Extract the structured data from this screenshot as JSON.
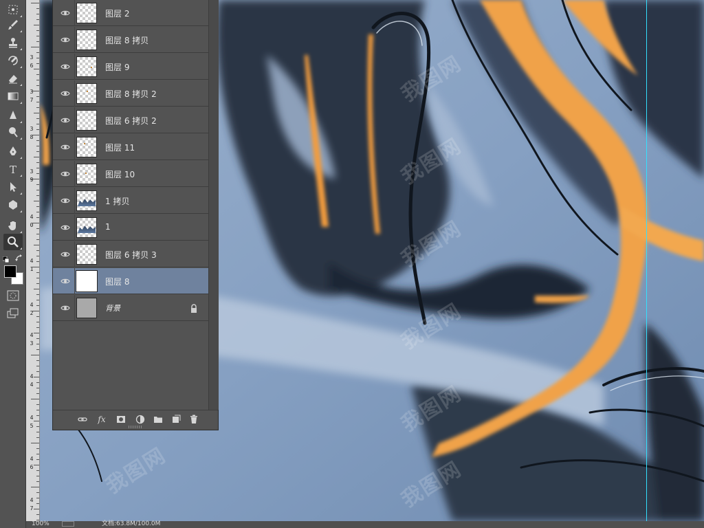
{
  "toolbar": {
    "tools": [
      {
        "name": "marquee-tool",
        "active": false
      },
      {
        "name": "brush-tool",
        "active": false
      },
      {
        "name": "stamp-tool",
        "active": false
      },
      {
        "name": "history-brush-tool",
        "active": false
      },
      {
        "name": "eraser-tool",
        "active": false
      },
      {
        "name": "gradient-tool",
        "active": false
      },
      {
        "name": "blur-tool",
        "active": false
      },
      {
        "name": "dodge-tool",
        "active": false
      },
      {
        "name": "pen-tool",
        "active": false
      },
      {
        "name": "type-tool",
        "active": false,
        "glyph": "T"
      },
      {
        "name": "path-select-tool",
        "active": false
      },
      {
        "name": "shape-tool",
        "active": false
      },
      {
        "name": "hand-tool",
        "active": false
      },
      {
        "name": "zoom-tool",
        "active": true
      }
    ],
    "foreground_color": "#000000",
    "background_color": "#ffffff"
  },
  "ruler": {
    "labels": [
      "3",
      "6",
      "3",
      "7",
      "3",
      "8",
      "3",
      "9",
      "4",
      "0",
      "4",
      "1",
      "4",
      "2",
      "4",
      "3",
      "4",
      "4",
      "4",
      "5",
      "4",
      "6",
      "4",
      "7"
    ]
  },
  "layers": [
    {
      "name": "图层 2",
      "thumb": "transparent"
    },
    {
      "name": "图层 8 拷贝",
      "thumb": "transparent"
    },
    {
      "name": "图层 9",
      "thumb": "transparent-dot"
    },
    {
      "name": "图层 8 拷贝 2",
      "thumb": "transparent-dot"
    },
    {
      "name": "图层 6 拷贝 2",
      "thumb": "transparent"
    },
    {
      "name": "图层 11",
      "thumb": "transparent-dot"
    },
    {
      "name": "图层 10",
      "thumb": "transparent-dot"
    },
    {
      "name": "1 拷贝",
      "thumb": "mountain"
    },
    {
      "name": "1",
      "thumb": "mountain"
    },
    {
      "name": "图层 6 拷贝 3",
      "thumb": "transparent"
    },
    {
      "name": "图层 8",
      "thumb": "white",
      "selected": true
    },
    {
      "name": "背景",
      "thumb": "grey",
      "locked": true
    }
  ],
  "layer_footer": [
    "link-icon",
    "fx-icon",
    "mask-icon",
    "adjustment-icon",
    "group-folder-icon",
    "new-layer-icon",
    "trash-icon"
  ],
  "layer_footer_fx": "fx",
  "watermark": "我图网",
  "status": {
    "zoom": "100%",
    "doc_info": "文档:63.8M/100.0M"
  },
  "colors": {
    "canvas_blue": "#8ea5c4",
    "canvas_dark": "#1a222c",
    "canvas_orange": "#f2a44c",
    "guide": "#33e0ff",
    "selected_layer": "#6f829e",
    "panel": "#535353"
  }
}
